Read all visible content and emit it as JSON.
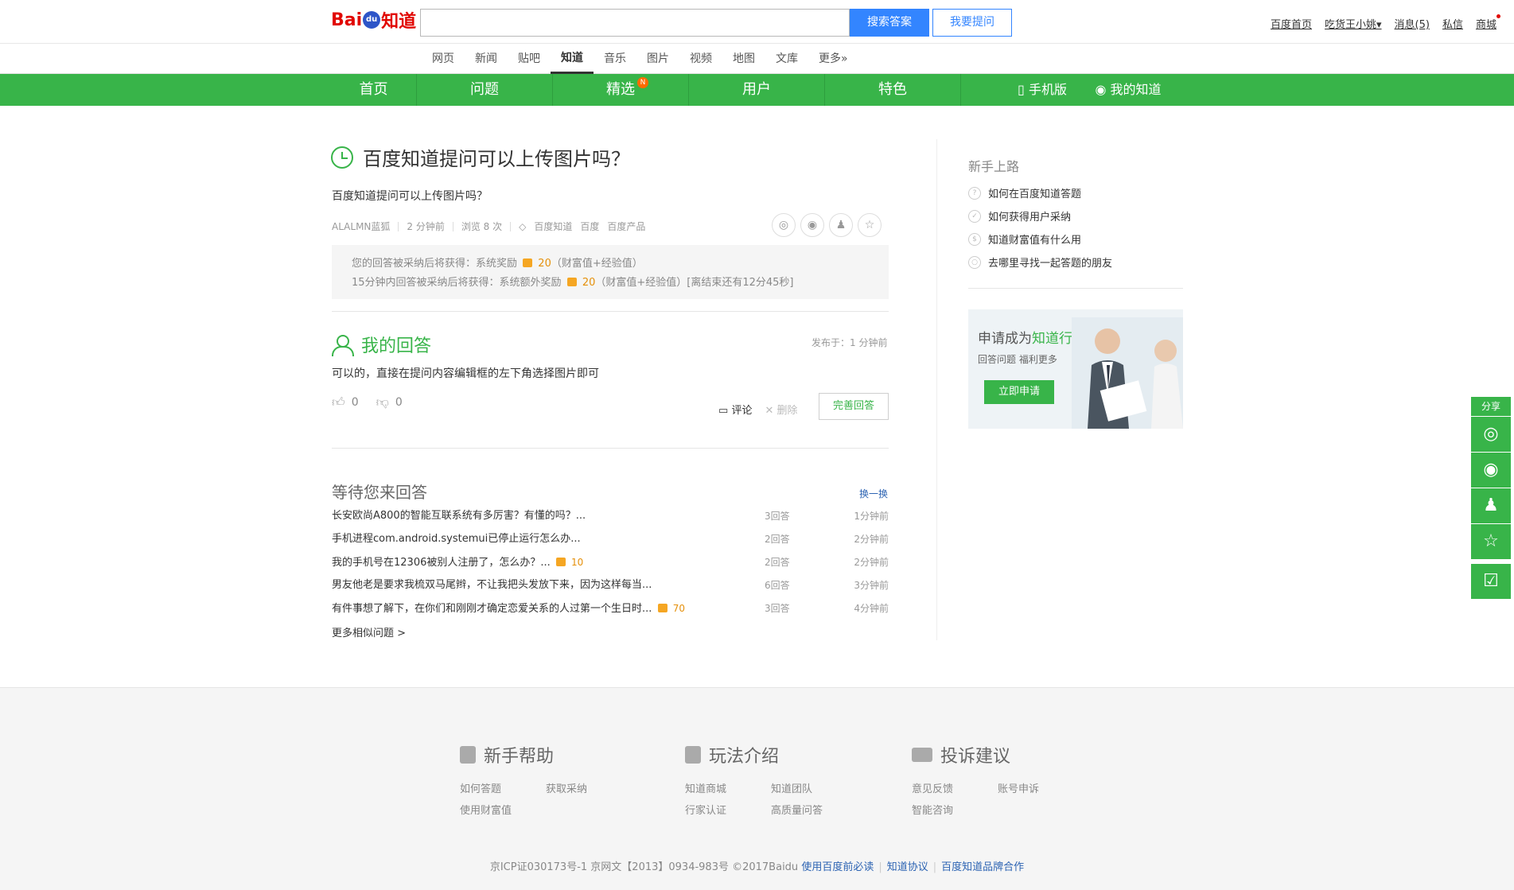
{
  "header": {
    "logo_bai": "Bai",
    "logo_du": "du",
    "logo_zd": "知道",
    "search_value": "",
    "search_button": "搜索答案",
    "ask_button": "我要提问",
    "user_links": [
      "百度首页",
      "吃货王小姚▾",
      "消息(5)",
      "私信",
      "商城"
    ]
  },
  "product_nav": [
    "网页",
    "新闻",
    "贴吧",
    "知道",
    "音乐",
    "图片",
    "视频",
    "地图",
    "文库",
    "更多»"
  ],
  "product_nav_active": "知道",
  "green_nav": {
    "items": [
      "首页",
      "问题",
      "精选",
      "用户",
      "特色"
    ],
    "badge": "N",
    "mobile": "手机版",
    "my": "我的知道"
  },
  "question": {
    "title": "百度知道提问可以上传图片吗？",
    "body": "百度知道提问可以上传图片吗？",
    "author": "ALALMN蓝狐",
    "time": "2 分钟前",
    "views": "浏览 8 次",
    "tags": [
      "百度知道",
      "百度",
      "百度产品"
    ],
    "reward_line1_prefix": "您的回答被采纳后将获得：系统奖励",
    "reward_line1_value": "20",
    "reward_line1_suffix": "（财富值+经验值）",
    "reward_line2_prefix": "15分钟内回答被采纳后将获得：系统额外奖励",
    "reward_line2_value": "20",
    "reward_line2_suffix": "（财富值+经验值）[离结束还有12分45秒]"
  },
  "answer": {
    "title": "我的回答",
    "time": "发布于：1 分钟前",
    "text": "可以的，直接在提问内容编辑框的左下角选择图片即可",
    "up": "0",
    "down": "0",
    "comment": "评论",
    "delete": "删除",
    "perfect_button": "完善回答"
  },
  "waiting": {
    "title": "等待您来回答",
    "refresh": "换一换",
    "items": [
      {
        "q": "长安欧尚A800的智能互联系统有多厉害？有懂的吗？...",
        "reward": "",
        "count": "3回答",
        "time": "1分钟前"
      },
      {
        "q": "手机进程com.android.systemui已停止运行怎么办...",
        "reward": "",
        "count": "2回答",
        "time": "2分钟前"
      },
      {
        "q": "我的手机号在12306被别人注册了，怎么办？...",
        "reward": "10",
        "count": "2回答",
        "time": "2分钟前"
      },
      {
        "q": "男友他老是要求我梳双马尾辫，不让我把头发放下来，因为这样每当...",
        "reward": "",
        "count": "6回答",
        "time": "3分钟前"
      },
      {
        "q": "有件事想了解下，在你们和刚刚才确定恋爱关系的人过第一个生日时...",
        "reward": "70",
        "count": "3回答",
        "time": "4分钟前"
      }
    ],
    "more": "更多相似问题 >"
  },
  "sidebar": {
    "title": "新手上路",
    "items": [
      "如何在百度知道答题",
      "如何获得用户采纳",
      "知道财富值有什么用",
      "去哪里寻找一起答题的朋友"
    ],
    "promo_prefix": "申请成为",
    "promo_highlight": "知道行家",
    "promo_sub": "回答问题   福利更多",
    "promo_button": "立即申请"
  },
  "float_share": {
    "label": "分享"
  },
  "footer": {
    "cols": [
      {
        "title": "新手帮助",
        "links": [
          "如何答题",
          "获取采纳",
          "使用财富值"
        ]
      },
      {
        "title": "玩法介绍",
        "links": [
          "知道商城",
          "知道团队",
          "行家认证",
          "高质量问答"
        ]
      },
      {
        "title": "投诉建议",
        "links": [
          "意见反馈",
          "账号申诉",
          "智能咨询"
        ]
      }
    ],
    "copyright_prefix": "京ICP证030173号-1   京网文【2013】0934-983号    ©2017Baidu",
    "copyright_links": [
      "使用百度前必读",
      "知道协议",
      "百度知道品牌合作"
    ]
  }
}
